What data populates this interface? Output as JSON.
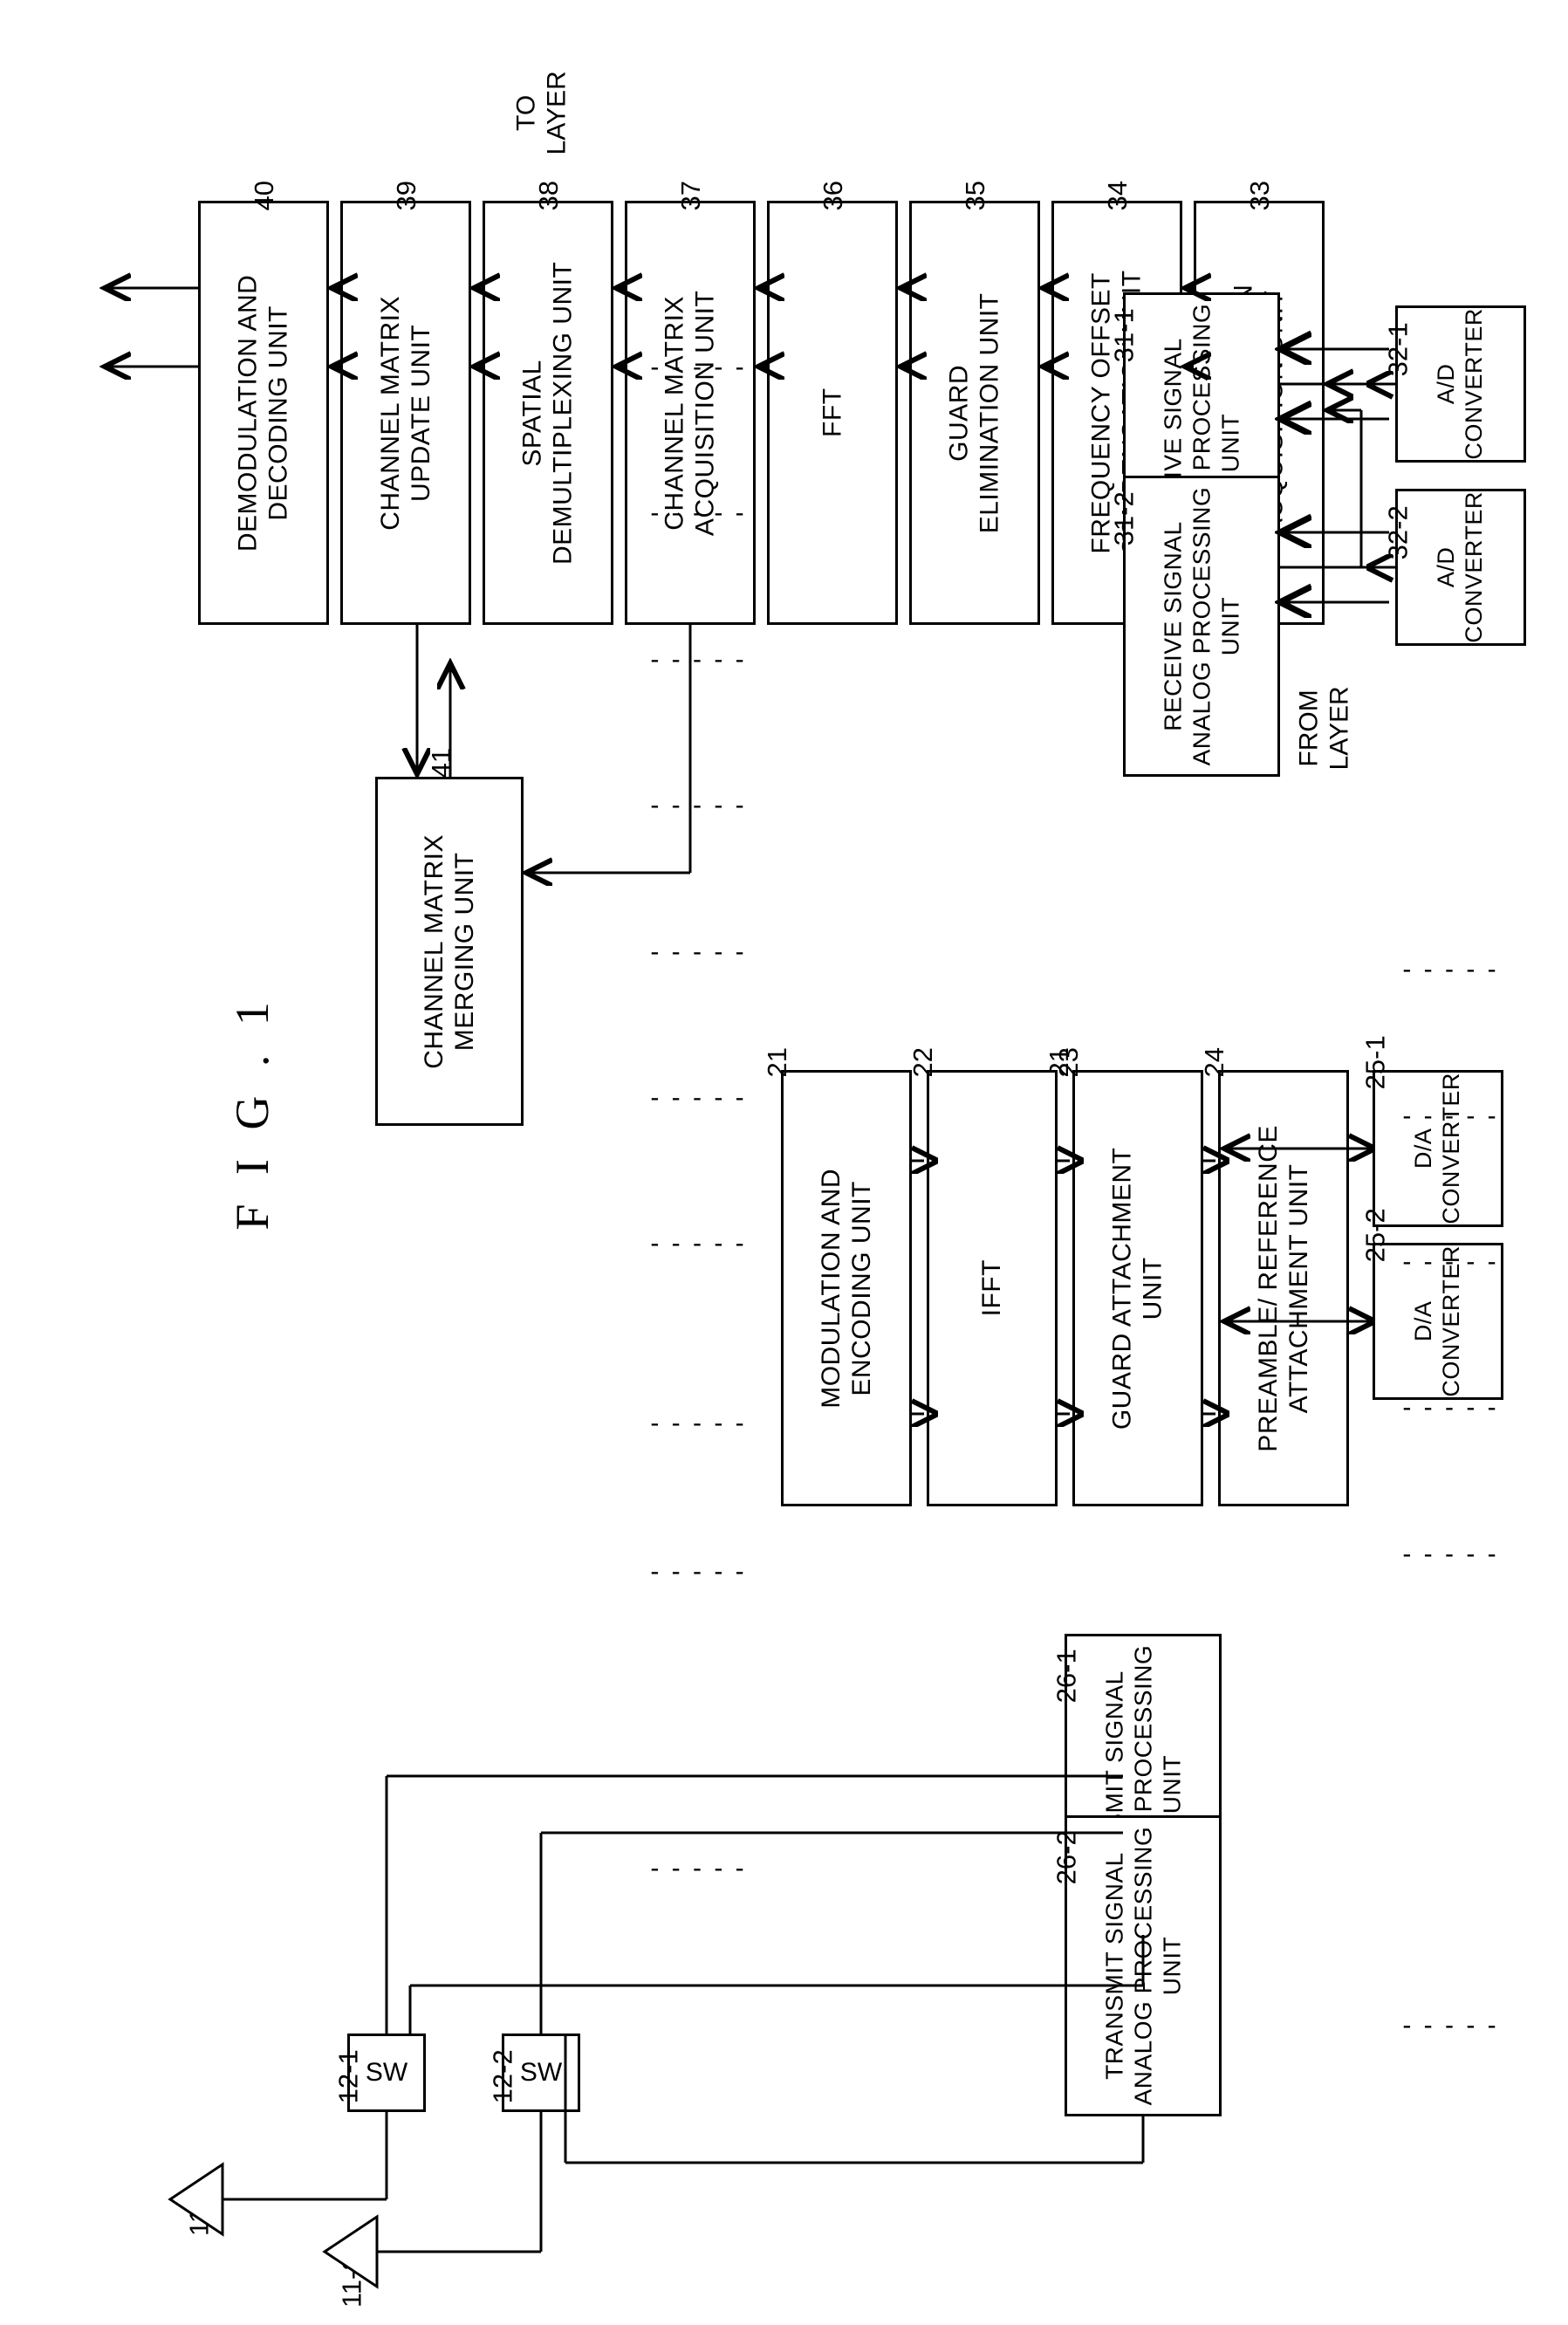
{
  "figure": {
    "title": "F I G . 1",
    "to_layer_label": "TO\nLAYER",
    "from_layer_label": "FROM\nLAYER",
    "ellipsis": "- - - - -"
  },
  "antennas": [
    {
      "ref": "11-1",
      "name": "antenna-1"
    },
    {
      "ref": "11-2",
      "name": "antenna-2"
    }
  ],
  "switches": [
    {
      "ref": "12-1",
      "label": "SW"
    },
    {
      "ref": "12-2",
      "label": "SW"
    }
  ],
  "receive_chain": [
    {
      "ref": "31-1",
      "label": "RECEIVE SIGNAL\nANALOG PROCESSING\nUNIT"
    },
    {
      "ref": "31-2",
      "label": "RECEIVE SIGNAL\nANALOG PROCESSING\nUNIT"
    },
    {
      "ref": "32-1",
      "label": "A/D\nCONVERTER"
    },
    {
      "ref": "32-2",
      "label": "A/D\nCONVERTER"
    },
    {
      "ref": "33",
      "label": "SYNCHRONIZATION\nACQUISITION UNIT"
    },
    {
      "ref": "34",
      "label": "FREQUENCY OFFSET\nCOMPENSATION UNIT"
    },
    {
      "ref": "35",
      "label": "GUARD\nELIMINATION UNIT"
    },
    {
      "ref": "36",
      "label": "FFT"
    },
    {
      "ref": "37",
      "label": "CHANNEL MATRIX\nACQUISITION UNIT"
    },
    {
      "ref": "38",
      "label": "SPATIAL\nDEMULTIPLEXING UNIT"
    },
    {
      "ref": "39",
      "label": "CHANNEL MATRIX\nUPDATE UNIT"
    },
    {
      "ref": "40",
      "label": "DEMODULATION AND\nDECODING UNIT"
    }
  ],
  "merging_unit": {
    "ref": "41",
    "label": "CHANNEL MATRIX\nMERGING UNIT"
  },
  "transmit_chain": [
    {
      "ref": "21",
      "label": "MODULATION AND\nENCODING UNIT"
    },
    {
      "ref": "22",
      "label": "IFFT"
    },
    {
      "ref": "23",
      "label": "GUARD ATTACHMENT\nUNIT"
    },
    {
      "ref": "24",
      "label": "PREAMBLE/ REFERENCE\nATTACHMENT UNIT"
    },
    {
      "ref": "25-1",
      "label": "D/A\nCONVERTER"
    },
    {
      "ref": "25-2",
      "label": "D/A\nCONVERTER"
    },
    {
      "ref": "26-1",
      "label": "TRANSMIT SIGNAL\nANALOG PROCESSING\nUNIT"
    },
    {
      "ref": "26-2",
      "label": "TRANSMIT SIGNAL\nANALOG PROCESSING\nUNIT"
    }
  ]
}
